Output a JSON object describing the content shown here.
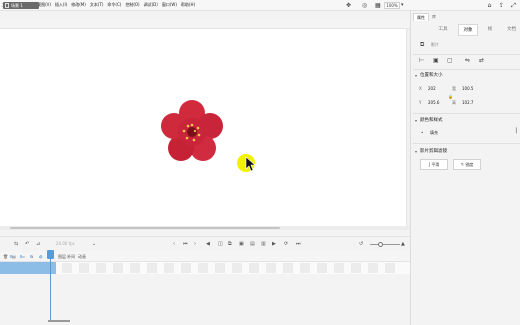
{
  "menu": {
    "items": [
      "文件(F)",
      "编辑(E)",
      "视图(V)",
      "插入(I)",
      "修改(M)",
      "文本(T)",
      "命令(C)",
      "控制(O)",
      "调试(D)",
      "窗口(W)",
      "帮助(H)"
    ]
  },
  "stage_toolbar": {
    "scene_label": "场景 1",
    "zoom_value": "100%"
  },
  "timeline": {
    "fps_text": "24.00 fps",
    "header_labels": [
      "图层",
      "补间",
      "动画"
    ]
  },
  "panel": {
    "tabs": [
      "属性",
      "库"
    ],
    "subtabs": [
      "工具",
      "对象",
      "帧",
      "文档"
    ],
    "object_type_label": "影片",
    "sections": {
      "position_size": "位置和大小",
      "color_style": "颜色和样式",
      "filters": "影片剪辑滤镜"
    },
    "fields": {
      "x_label": "X",
      "x_value": "202",
      "w_label": "宽",
      "w_value": "100.5",
      "y_label": "Y",
      "y_value": "205.6",
      "h_label": "高",
      "h_value": "102.7"
    },
    "color_effect_label": "填充",
    "filter_buttons": [
      "平滑",
      "锐度"
    ]
  },
  "colors": {
    "selection": "#8cbde6",
    "playhead": "#5b9bd5",
    "flower": "#d22a3d",
    "cursor_highlight": "#f2f200"
  },
  "icons": [
    "home-icon",
    "share-icon",
    "expand-icon",
    "snap-icon",
    "clip-icon",
    "grid-icon",
    "play-icon",
    "stop-icon",
    "loop-icon",
    "trash-icon",
    "new-layer-icon",
    "folder-icon",
    "link-icon",
    "flip-icon"
  ]
}
